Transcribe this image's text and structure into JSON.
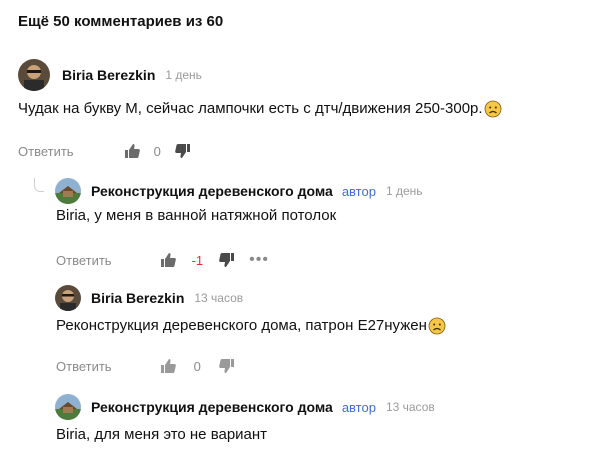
{
  "header": {
    "title": "Ещё 50 комментариев из 60"
  },
  "comments": [
    {
      "author": "Biria Berezkin",
      "badge": "",
      "time": "1 день",
      "text": "Чудак на букву М, сейчас лампочки есть с дтч/движения 250-300р.",
      "reply_label": "Ответить",
      "score": "0"
    },
    {
      "author": "Реконструкция деревенского дома",
      "badge": "автор",
      "time": "1 день",
      "text": "Biria, у меня в ванной натяжной потолок",
      "reply_label": "Ответить",
      "score": "-1",
      "more": "•••"
    },
    {
      "author": "Biria Berezkin",
      "badge": "",
      "time": "13 часов",
      "text": "Реконструкция деревенского дома, патрон Е27нужен",
      "reply_label": "Ответить",
      "score": "0"
    },
    {
      "author": "Реконструкция деревенского дома",
      "badge": "автор",
      "time": "13 часов",
      "text": "Biria, для меня это не вариант"
    }
  ],
  "colors": {
    "accent": "#3a6fd8",
    "negative": "#e0312f",
    "muted": "#8a8a8a"
  },
  "icons": [
    "thumbs-up-icon",
    "thumbs-down-icon",
    "sad-emoji-icon",
    "more-icon"
  ]
}
